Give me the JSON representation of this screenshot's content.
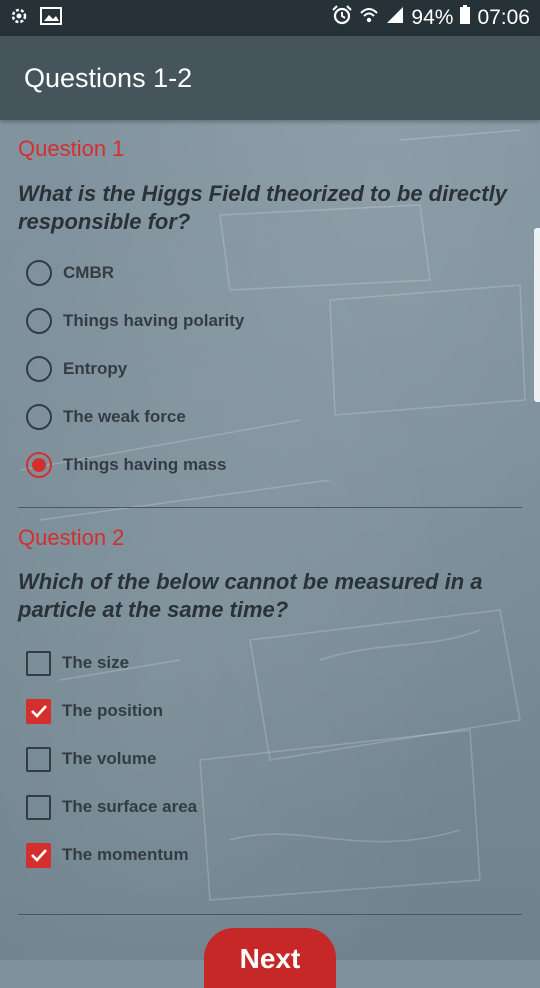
{
  "status_bar": {
    "battery": "94%",
    "time": "07:06"
  },
  "app_bar": {
    "title": "Questions 1-2"
  },
  "question1": {
    "label": "Question 1",
    "text": "What is the Higgs Field theorized to be directly responsible for?",
    "type": "single-choice",
    "options": [
      {
        "label": "CMBR",
        "selected": false
      },
      {
        "label": "Things having polarity",
        "selected": false
      },
      {
        "label": "Entropy",
        "selected": false
      },
      {
        "label": "The weak force",
        "selected": false
      },
      {
        "label": "Things having mass",
        "selected": true
      }
    ]
  },
  "question2": {
    "label": "Question 2",
    "text": "Which of the below cannot be measured in a particle at the same time?",
    "type": "multi-choice",
    "options": [
      {
        "label": "The size",
        "selected": false
      },
      {
        "label": "The position",
        "selected": true
      },
      {
        "label": "The volume",
        "selected": false
      },
      {
        "label": "The surface area",
        "selected": false
      },
      {
        "label": "The momentum",
        "selected": true
      }
    ]
  },
  "next_button": {
    "label": "Next"
  },
  "colors": {
    "accent": "#d32f2f",
    "status_bar": "#263238",
    "app_bar": "#46545c"
  }
}
